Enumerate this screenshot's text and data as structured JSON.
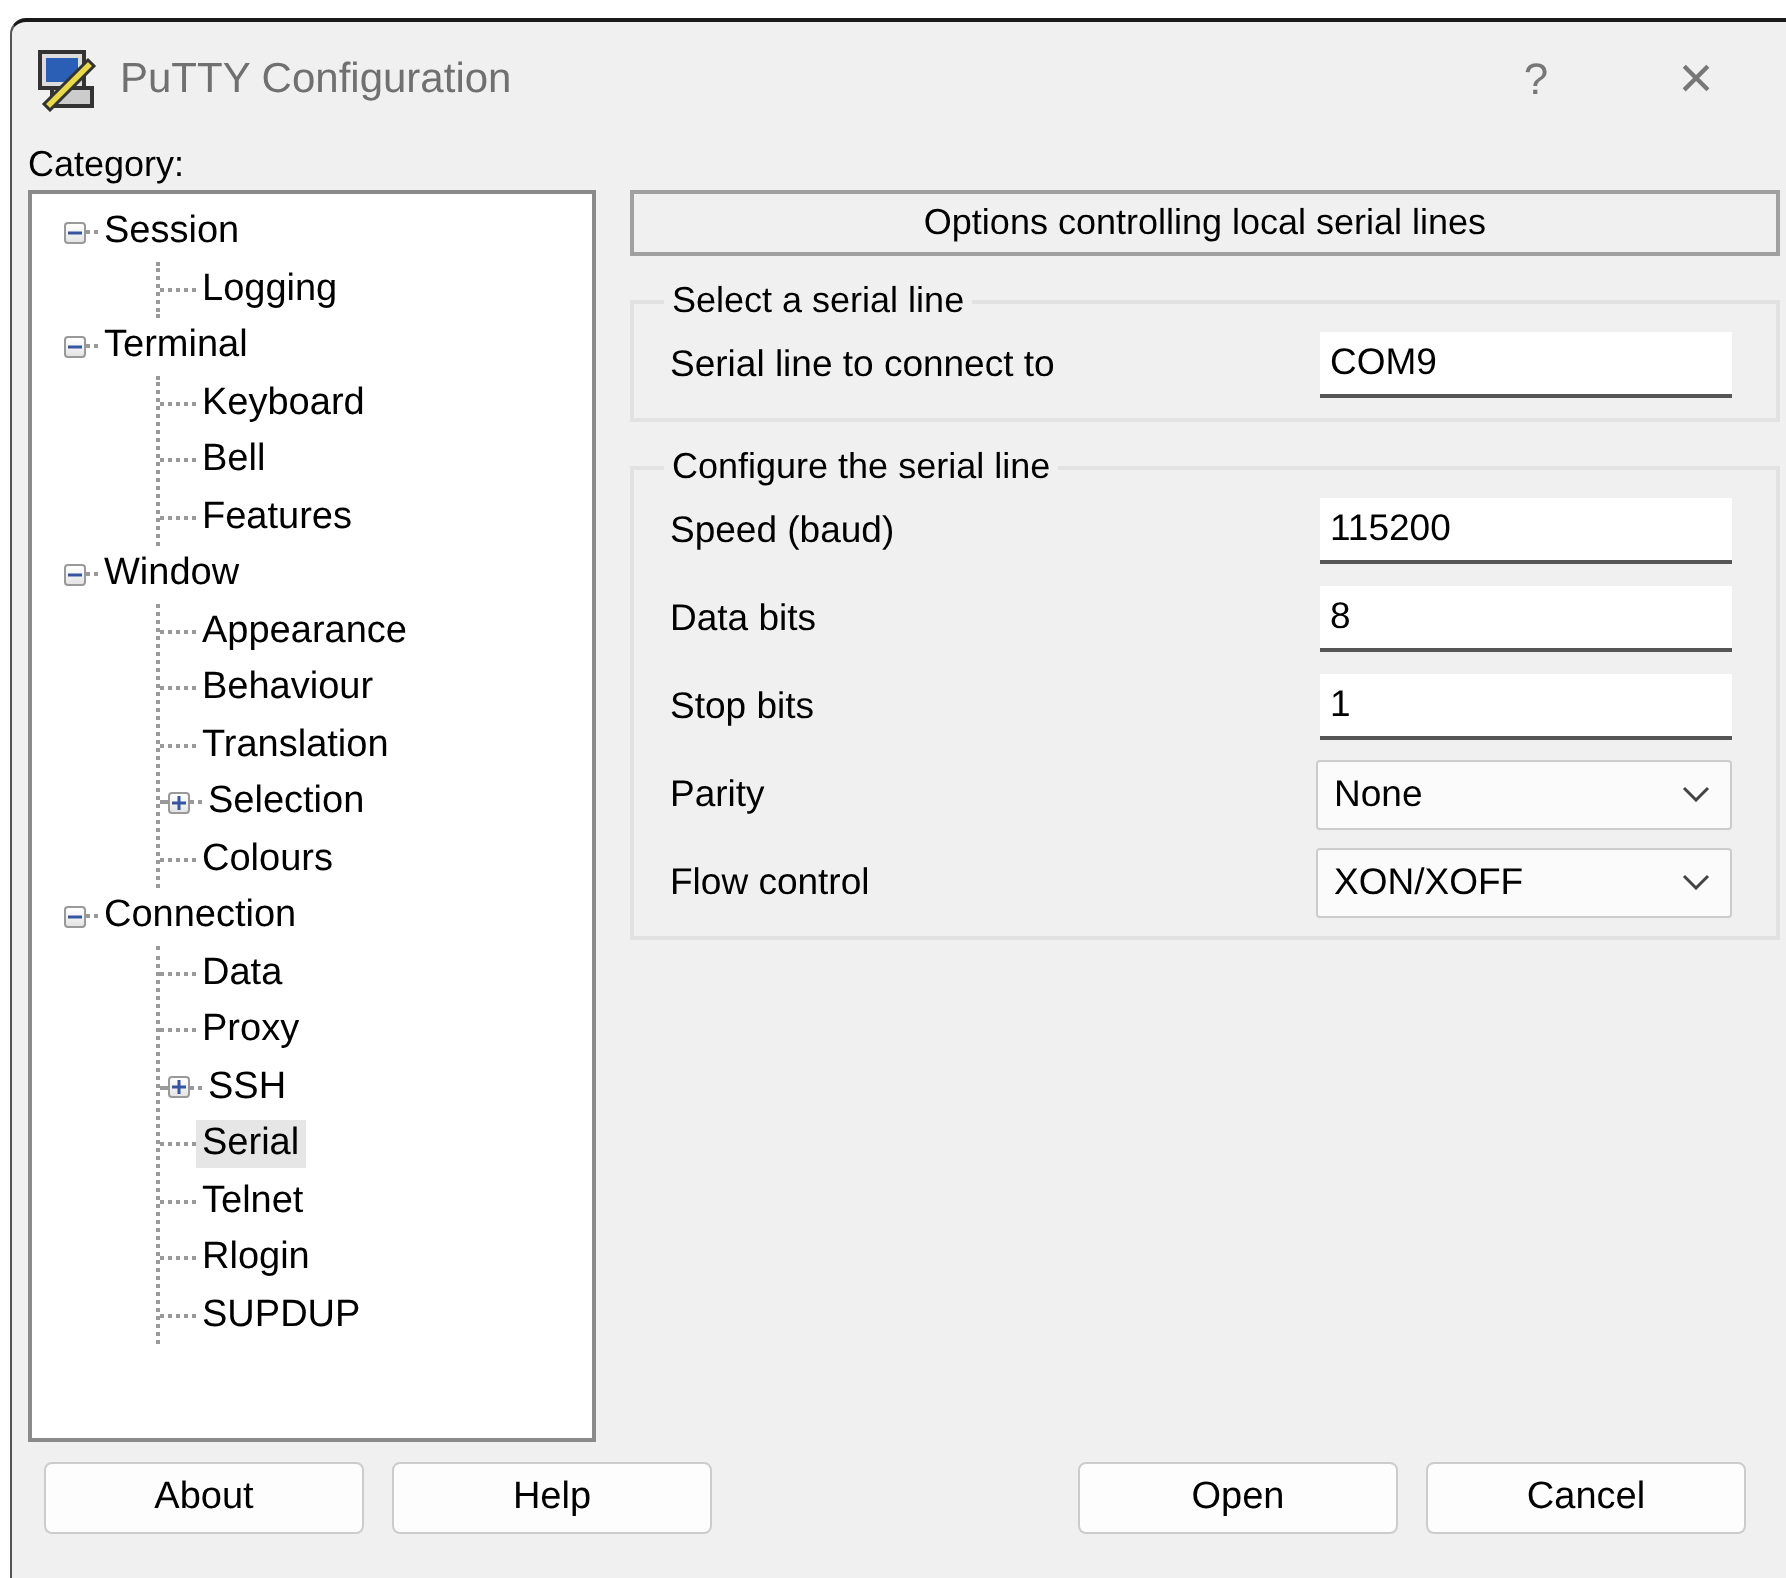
{
  "window": {
    "title": "PuTTY Configuration",
    "title_buttons": [
      "?",
      "×"
    ]
  },
  "category_label": "Category:",
  "tree": [
    {
      "label": "Session",
      "expanded": true,
      "selected": false,
      "children": [
        {
          "label": "Logging",
          "selected": false
        }
      ]
    },
    {
      "label": "Terminal",
      "expanded": true,
      "selected": false,
      "children": [
        {
          "label": "Keyboard",
          "selected": false
        },
        {
          "label": "Bell",
          "selected": false
        },
        {
          "label": "Features",
          "selected": false
        }
      ]
    },
    {
      "label": "Window",
      "expanded": true,
      "selected": false,
      "children": [
        {
          "label": "Appearance",
          "selected": false
        },
        {
          "label": "Behaviour",
          "selected": false
        },
        {
          "label": "Translation",
          "selected": false
        },
        {
          "label": "Selection",
          "expanded": false,
          "selected": false
        },
        {
          "label": "Colours",
          "selected": false
        }
      ]
    },
    {
      "label": "Connection",
      "expanded": true,
      "selected": false,
      "children": [
        {
          "label": "Data",
          "selected": false
        },
        {
          "label": "Proxy",
          "selected": false
        },
        {
          "label": "SSH",
          "expanded": false,
          "selected": false
        },
        {
          "label": "Serial",
          "selected": true
        },
        {
          "label": "Telnet",
          "selected": false
        },
        {
          "label": "Rlogin",
          "selected": false
        },
        {
          "label": "SUPDUP",
          "selected": false
        }
      ]
    }
  ],
  "panel": {
    "header": "Options controlling local serial lines",
    "groups": [
      {
        "title": "Select a serial line",
        "fields": [
          {
            "label": "Serial line to connect to",
            "kind": "text",
            "value": "COM9"
          }
        ]
      },
      {
        "title": "Configure the serial line",
        "fields": [
          {
            "label": "Speed (baud)",
            "kind": "text",
            "value": "115200"
          },
          {
            "label": "Data bits",
            "kind": "text",
            "value": "8"
          },
          {
            "label": "Stop bits",
            "kind": "text",
            "value": "1"
          },
          {
            "label": "Parity",
            "kind": "select",
            "value": "None"
          },
          {
            "label": "Flow control",
            "kind": "select",
            "value": "XON/XOFF"
          }
        ]
      }
    ]
  },
  "buttons_left": [
    "About",
    "Help"
  ],
  "buttons_right": [
    "Open",
    "Cancel"
  ]
}
